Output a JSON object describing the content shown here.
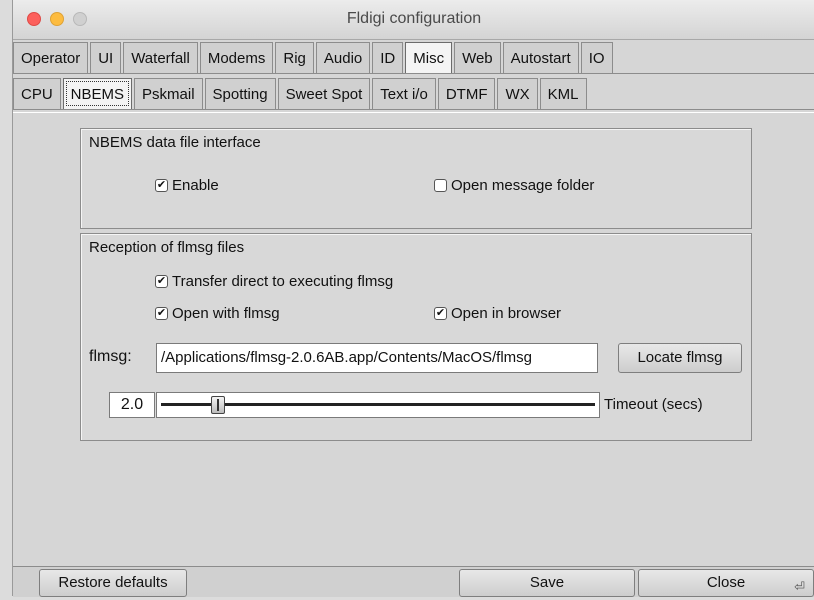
{
  "window": {
    "title": "Fldigi configuration"
  },
  "tabs_main": [
    "Operator",
    "UI",
    "Waterfall",
    "Modems",
    "Rig",
    "Audio",
    "ID",
    "Misc",
    "Web",
    "Autostart",
    "IO"
  ],
  "tabs_main_active": "Misc",
  "tabs_sub": [
    "CPU",
    "NBEMS",
    "Pskmail",
    "Spotting",
    "Sweet Spot",
    "Text i/o",
    "DTMF",
    "WX",
    "KML"
  ],
  "tabs_sub_active": "NBEMS",
  "nbems_group": {
    "title": "NBEMS data file interface",
    "enable": {
      "label": "Enable",
      "checked": true
    },
    "open_folder": {
      "label": "Open message folder",
      "checked": false
    }
  },
  "reception_group": {
    "title": "Reception of flmsg files",
    "transfer_direct": {
      "label": "Transfer direct to executing flmsg",
      "checked": true
    },
    "open_with": {
      "label": "Open with flmsg",
      "checked": true
    },
    "open_browser": {
      "label": "Open in browser",
      "checked": true
    },
    "flmsg_label": "flmsg:",
    "flmsg_path": "/Applications/flmsg-2.0.6AB.app/Contents/MacOS/flmsg",
    "locate_button": "Locate flmsg",
    "timeout_value": "2.0",
    "timeout_label": "Timeout (secs)",
    "timeout_fraction": 0.12
  },
  "buttons": {
    "restore": "Restore defaults",
    "save": "Save",
    "close": "Close"
  },
  "icons": {
    "check": "checkmark-icon",
    "return": "return-key-icon"
  }
}
